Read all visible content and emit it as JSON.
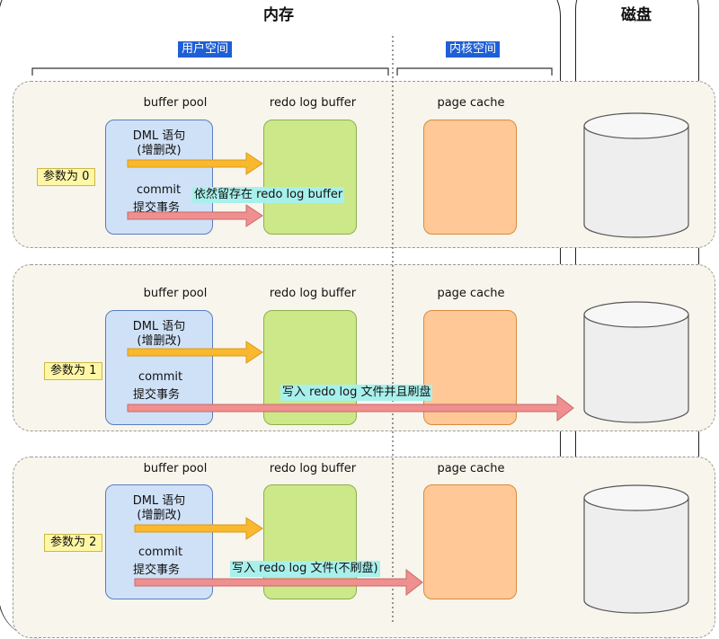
{
  "titles": {
    "memory": "内存",
    "disk": "磁盘"
  },
  "spaces": {
    "user": "用户空间",
    "kernel": "内核空间"
  },
  "scenarios": [
    {
      "param": "参数为 0",
      "buffer_pool": "buffer pool",
      "redo_log_buffer": "redo log buffer",
      "page_cache": "page cache",
      "dml_line1": "DML 语句",
      "dml_line2": "(增删改)",
      "commit_line1": "commit",
      "commit_line2": "提交事务",
      "note": "依然留存在 redo log buffer"
    },
    {
      "param": "参数为 1",
      "buffer_pool": "buffer pool",
      "redo_log_buffer": "redo log buffer",
      "page_cache": "page cache",
      "dml_line1": "DML 语句",
      "dml_line2": "(增删改)",
      "commit_line1": "commit",
      "commit_line2": "提交事务",
      "note": "写入 redo log 文件并且刷盘"
    },
    {
      "param": "参数为 2",
      "buffer_pool": "buffer pool",
      "redo_log_buffer": "redo log buffer",
      "page_cache": "page cache",
      "dml_line1": "DML 语句",
      "dml_line2": "(增删改)",
      "commit_line1": "commit",
      "commit_line2": "提交事务",
      "note": "写入 redo log 文件(不刷盘)"
    }
  ],
  "colors": {
    "scenario_bg": "#f8f5ec",
    "buffer_pool": "#cfe1f7",
    "redo_log_buffer": "#cce888",
    "page_cache": "#ffc896",
    "dml_arrow": "#f9b82d",
    "commit_arrow": "#ef8f8f",
    "space_label": "#1e5fd6",
    "param_bg": "#fff7a6",
    "note_bg": "#a8f0ec"
  },
  "icons": {
    "disk": "disk-cylinder-icon",
    "arrow": "arrow-right-icon"
  }
}
